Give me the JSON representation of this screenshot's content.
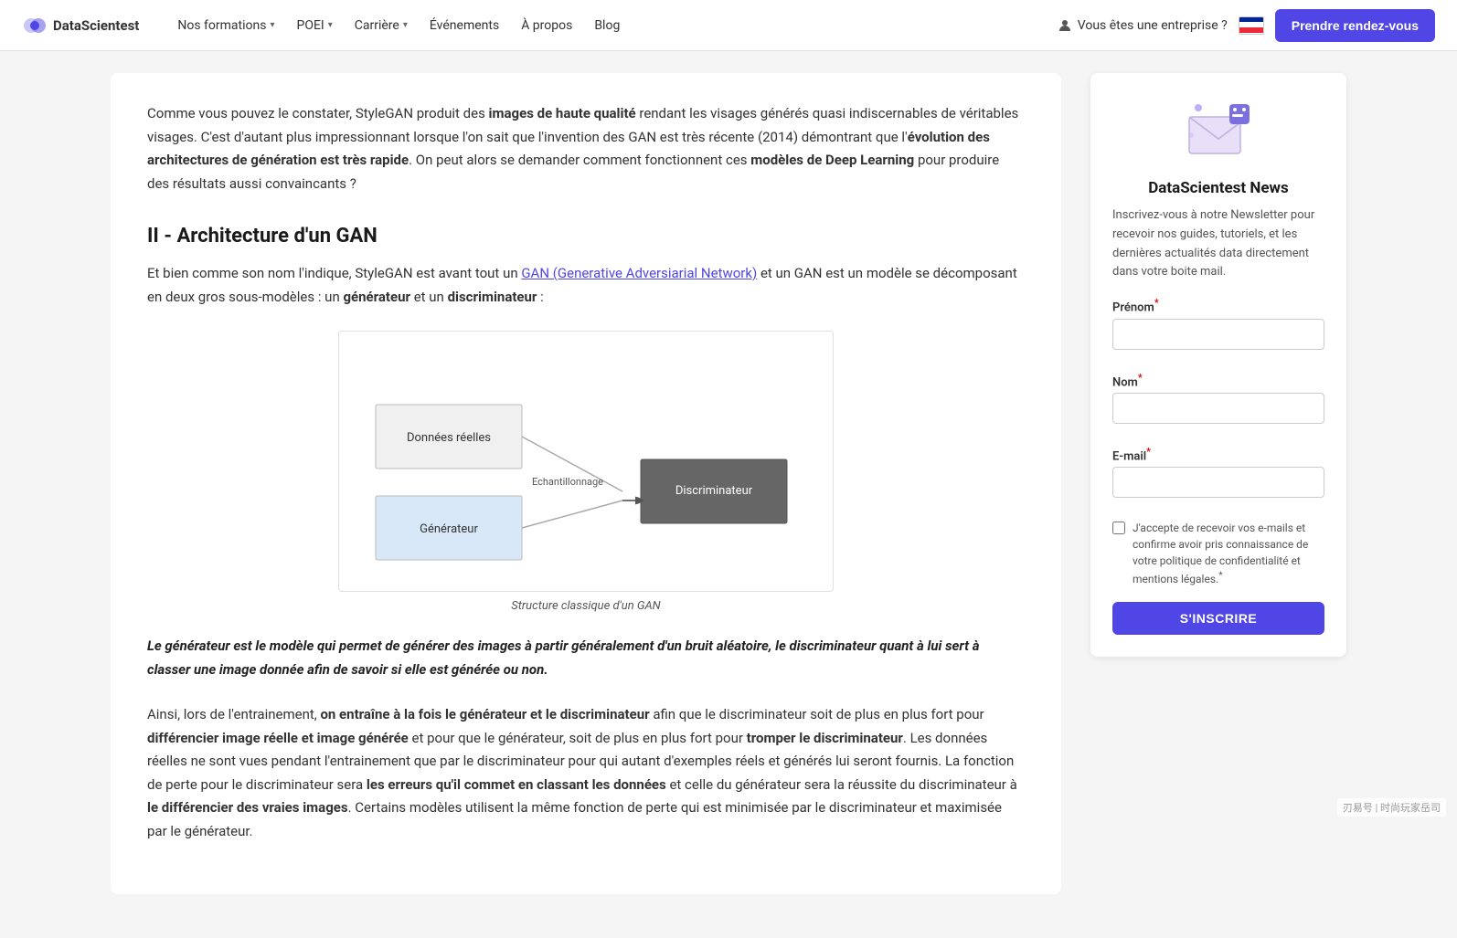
{
  "nav": {
    "logo_text": "DataScientest",
    "formations_label": "Nos formations",
    "poei_label": "POEI",
    "carriere_label": "Carrière",
    "evenements_label": "Événements",
    "apropos_label": "À propos",
    "blog_label": "Blog",
    "enterprise_label": "Vous êtes une entreprise ?",
    "rdv_label": "Prendre rendez-vous"
  },
  "article": {
    "para1": "Comme vous pouvez le constater, StyleGAN produit des ",
    "para1_bold1": "images de haute qualité",
    "para1_rest": " rendant les visages générés quasi indiscernables de véritables visages. C'est d'autant plus impressionnant lorsque l'on sait que l'invention des GAN est très récente (2014) démontrant que l'",
    "para1_bold2": "évolution des architectures de génération est très rapide",
    "para1_end": ". On peut alors se demander comment fonctionnent ces ",
    "para1_bold3": "modèles de Deep Learning",
    "para1_final": " pour produire des résultats aussi convaincants ?",
    "section_title": "II - Architecture d'un GAN",
    "para2_start": "Et bien comme son nom l'indique, StyleGAN est avant tout un ",
    "para2_link": "GAN (Generative Adversiarial Network)",
    "para2_rest": " et un GAN est un modèle se décomposant en deux gros sous-modèles : un ",
    "para2_bold1": "générateur",
    "para2_mid": " et un ",
    "para2_bold2": "discriminateur",
    "para2_end": " :",
    "diagram_caption": "Structure classique d'un GAN",
    "diagram_node1": "Données réelles",
    "diagram_node2": "Générateur",
    "diagram_node3": "Echantillonnage",
    "diagram_node4": "Discriminateur",
    "blockquote": "Le générateur est le modèle qui permet de générer des images à partir généralement d'un bruit aléatoire, le discriminateur quant à lui sert à classer une image donnée afin de savoir si elle est générée ou non.",
    "para3_start": "Ainsi, lors de l'entrainement, ",
    "para3_bold1": "on entraîne à la fois le générateur et le discriminateur",
    "para3_rest": " afin que le discriminateur soit de plus en plus fort pour ",
    "para3_bold2": "différencier image réelle et image générée",
    "para3_mid": " et pour que le générateur, soit de plus en plus fort pour ",
    "para3_bold3": "tromper le discriminateur",
    "para3_cont": ". Les données réelles ne sont vues pendant l'entrainement que par le discriminateur pour qui autant d'exemples réels et générés lui seront fournis. La fonction de perte pour le discriminateur sera ",
    "para3_bold4": "les erreurs qu'il commet en classant les données",
    "para3_cont2": " et celle du générateur sera la réussite du discriminateur à ",
    "para3_bold5": "le différencier des vraies images",
    "para3_end": ". Certains modèles utilisent la même fonction de perte qui est minimisée par le discriminateur et maximisée par le générateur."
  },
  "sidebar": {
    "news_title": "DataScientest News",
    "news_desc": "Inscrivez-vous à notre Newsletter pour recevoir nos guides, tutoriels, et les dernières actualités data directement dans votre boite mail.",
    "prenom_label": "Prénom",
    "nom_label": "Nom",
    "email_label": "E-mail",
    "required_marker": "*",
    "checkbox_text": "J'accepte de recevoir vos e-mails et confirme avoir pris connaissance de votre politique de confidentialité et mentions légales.",
    "subscribe_btn": "S'INSCRIRE"
  },
  "watermark": "刃易号 | 时尚玩家岳司"
}
